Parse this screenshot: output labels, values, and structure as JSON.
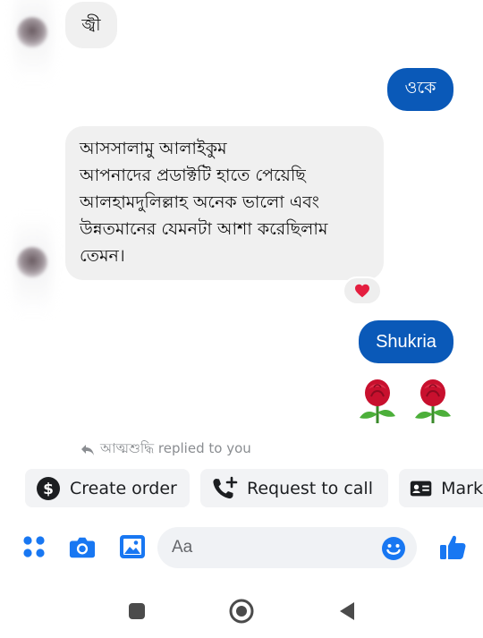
{
  "thread": {
    "messages": [
      {
        "from": "them",
        "text": "জ্বী"
      },
      {
        "from": "me",
        "text": "ওকে"
      },
      {
        "from": "them",
        "lines": [
          "আসসালামু আলাইকুম",
          "আপনাদের প্রডাক্টটি হাতে পেয়েছি",
          "আলহামদুলিল্লাহ অনেক ভালো এবং",
          "উন্নতমানের যেমনটা আশা করেছিলাম",
          "তেমন।"
        ],
        "reaction": "heart-icon"
      },
      {
        "from": "me",
        "text": "Shukria"
      },
      {
        "from": "me",
        "emoji": "🌹 🌹"
      }
    ],
    "reply_note": "আত্মশুদ্ধি replied to you"
  },
  "quick_actions": [
    {
      "icon": "dollar-icon",
      "label": "Create order"
    },
    {
      "icon": "phone-plus-icon",
      "label": "Request to call"
    },
    {
      "icon": "id-card-icon",
      "label": "Mark"
    }
  ],
  "composer": {
    "placeholder": "Aa"
  },
  "colors": {
    "accent": "#0a59b8",
    "messenger_blue": "#1877f2",
    "bubble_gray": "#f0f0f0",
    "heart": "#e41e3f"
  }
}
